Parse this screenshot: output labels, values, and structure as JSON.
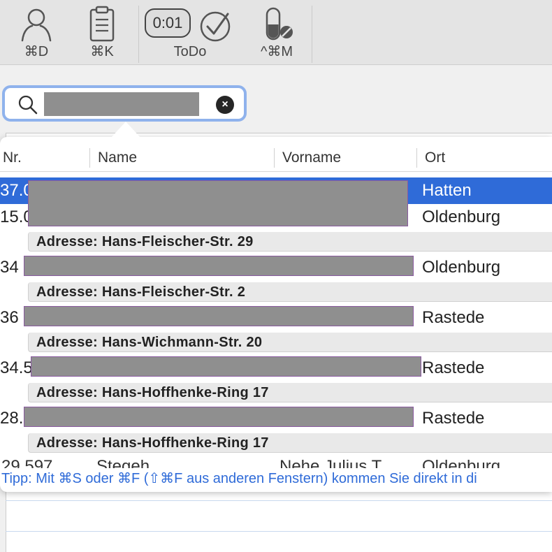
{
  "toolbar": {
    "buttons": [
      {
        "icon": "person-icon",
        "shortcut": "⌘D"
      },
      {
        "icon": "clipboard-icon",
        "shortcut": "⌘K"
      },
      {
        "icon": "timer-icon",
        "timer": "0:01",
        "shortcut": "ToDo"
      },
      {
        "icon": "checkmark-circle-icon",
        "shortcut": ""
      },
      {
        "icon": "medication-icon",
        "shortcut": "^⌘M"
      }
    ]
  },
  "search": {
    "value": "",
    "clear_icon": "×"
  },
  "table": {
    "columns": [
      "Nr.",
      "Name",
      "Vorname",
      "Ort"
    ],
    "rows": [
      {
        "nr": "37.0",
        "ort": "Hatten",
        "selected": true,
        "address": ""
      },
      {
        "nr": "15.0",
        "ort": "Oldenburg",
        "selected": false,
        "address": "Adresse: Hans-Fleischer-Str. 29"
      },
      {
        "nr": "34",
        "ort": "Oldenburg",
        "selected": false,
        "address": "Adresse: Hans-Fleischer-Str. 2"
      },
      {
        "nr": "36",
        "ort": "Rastede",
        "selected": false,
        "address": "Adresse: Hans-Wichmann-Str. 20"
      },
      {
        "nr": "34.5",
        "ort": "Rastede",
        "selected": false,
        "address": "Adresse: Hans-Hoffhenke-Ring 17"
      },
      {
        "nr": "28.",
        "ort": "Rastede",
        "selected": false,
        "address": "Adresse: Hans-Hoffhenke-Ring 17"
      }
    ],
    "cutoff_row": {
      "nr": "29.597",
      "name": "Stegeh",
      "vorname": "Nehe Julius T.",
      "ort": "Oldenburg"
    }
  },
  "tip": "Tipp: Mit ⌘S oder ⌘F (⇧⌘F aus anderen Fenstern) kommen Sie direkt in di",
  "colors": {
    "selection": "#2f6bd8",
    "focus_ring": "#8fb2ec",
    "tip_text": "#2f6bd8"
  }
}
